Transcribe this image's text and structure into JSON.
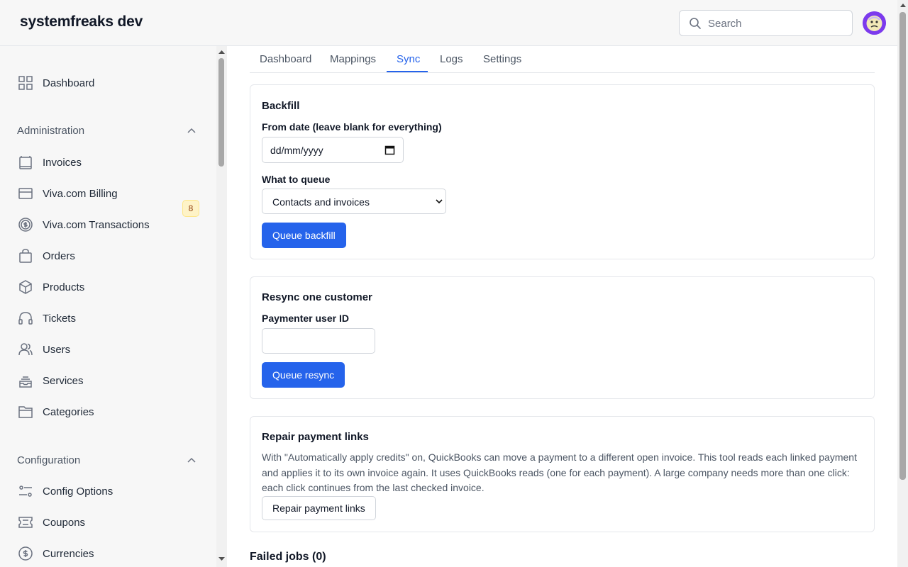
{
  "app": {
    "title": "systemfreaks dev"
  },
  "search": {
    "placeholder": "Search"
  },
  "sidebar": {
    "dashboard": "Dashboard",
    "admin_section": "Administration",
    "admin_items": [
      {
        "label": "Invoices",
        "icon": "invoice-icon",
        "badge": "8"
      },
      {
        "label": "Viva.com Billing",
        "icon": "card-icon"
      },
      {
        "label": "Viva.com Transactions",
        "icon": "dollar-circle-icon"
      },
      {
        "label": "Orders",
        "icon": "bag-icon"
      },
      {
        "label": "Products",
        "icon": "box-icon"
      },
      {
        "label": "Tickets",
        "icon": "headset-icon"
      },
      {
        "label": "Users",
        "icon": "users-icon"
      },
      {
        "label": "Services",
        "icon": "stack-icon"
      },
      {
        "label": "Categories",
        "icon": "folder-icon"
      }
    ],
    "config_section": "Configuration",
    "config_items": [
      {
        "label": "Config Options",
        "icon": "sliders-icon"
      },
      {
        "label": "Coupons",
        "icon": "coupon-icon"
      },
      {
        "label": "Currencies",
        "icon": "currency-icon"
      }
    ]
  },
  "tabs": [
    {
      "label": "Dashboard"
    },
    {
      "label": "Mappings"
    },
    {
      "label": "Sync",
      "active": true
    },
    {
      "label": "Logs"
    },
    {
      "label": "Settings"
    }
  ],
  "backfill": {
    "title": "Backfill",
    "from_label": "From date (leave blank for everything)",
    "date_placeholder": "dd/mm/yyyy",
    "queue_label": "What to queue",
    "queue_selected": "Contacts and invoices",
    "button": "Queue backfill"
  },
  "resync": {
    "title": "Resync one customer",
    "user_label": "Paymenter user ID",
    "user_value": "",
    "button": "Queue resync"
  },
  "repair": {
    "title": "Repair payment links",
    "description": "With \"Automatically apply credits\" on, QuickBooks can move a payment to a different open invoice. This tool reads each linked payment and applies it to its own invoice again. It uses QuickBooks reads (one for each payment). A large company needs more than one click: each click continues from the last checked invoice.",
    "button": "Repair payment links"
  },
  "failed_jobs": {
    "title": "Failed jobs (0)"
  },
  "colors": {
    "accent": "#2563eb",
    "sidebar_bg": "#f7f7f7"
  }
}
